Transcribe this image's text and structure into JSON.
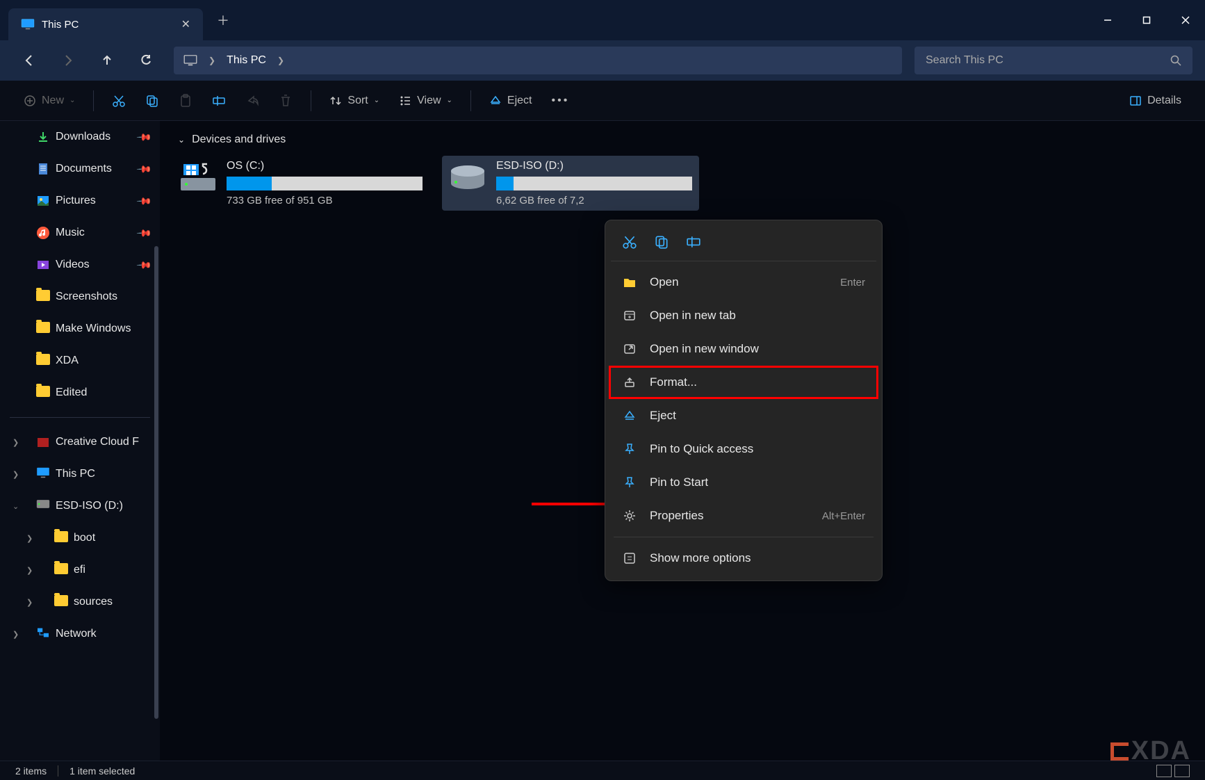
{
  "titlebar": {
    "tab_title": "This PC"
  },
  "breadcrumb": {
    "location": "This PC"
  },
  "search": {
    "placeholder": "Search This PC"
  },
  "toolbar": {
    "new": "New",
    "sort": "Sort",
    "view": "View",
    "eject": "Eject",
    "details": "Details"
  },
  "sidebar": {
    "quick": [
      {
        "label": "Downloads",
        "icon": "download",
        "pinned": true
      },
      {
        "label": "Documents",
        "icon": "doc",
        "pinned": true
      },
      {
        "label": "Pictures",
        "icon": "pic",
        "pinned": true
      },
      {
        "label": "Music",
        "icon": "music",
        "pinned": true
      },
      {
        "label": "Videos",
        "icon": "video",
        "pinned": true
      },
      {
        "label": "Screenshots",
        "icon": "folder",
        "pinned": false
      },
      {
        "label": "Make Windows",
        "icon": "folder",
        "pinned": false
      },
      {
        "label": "XDA",
        "icon": "folder",
        "pinned": false
      },
      {
        "label": "Edited",
        "icon": "folder",
        "pinned": false
      }
    ],
    "tree": [
      {
        "label": "Creative Cloud F",
        "icon": "cc",
        "chev": "right"
      },
      {
        "label": "This PC",
        "icon": "pc",
        "chev": "right"
      },
      {
        "label": "ESD-ISO (D:)",
        "icon": "drive",
        "chev": "down"
      },
      {
        "label": "boot",
        "icon": "folder",
        "nested": true,
        "chev": "right"
      },
      {
        "label": "efi",
        "icon": "folder",
        "nested": true,
        "chev": "right"
      },
      {
        "label": "sources",
        "icon": "folder",
        "nested": true,
        "chev": "right"
      },
      {
        "label": "Network",
        "icon": "net",
        "chev": "right"
      }
    ]
  },
  "section": {
    "header": "Devices and drives"
  },
  "drives": [
    {
      "name": "OS (C:)",
      "free": "733 GB free of 951 GB",
      "pct": 23,
      "selected": false
    },
    {
      "name": "ESD-ISO (D:)",
      "free": "6,62 GB free of 7,2",
      "pct": 9,
      "selected": true
    }
  ],
  "context": {
    "items": [
      {
        "label": "Open",
        "icon": "open",
        "key": "Enter"
      },
      {
        "label": "Open in new tab",
        "icon": "newtab"
      },
      {
        "label": "Open in new window",
        "icon": "newwin"
      },
      {
        "label": "Format...",
        "icon": "format",
        "highlight": true
      },
      {
        "label": "Eject",
        "icon": "eject"
      },
      {
        "label": "Pin to Quick access",
        "icon": "pin"
      },
      {
        "label": "Pin to Start",
        "icon": "pin"
      },
      {
        "label": "Properties",
        "icon": "props",
        "key": "Alt+Enter"
      }
    ],
    "more": "Show more options"
  },
  "status": {
    "count": "2 items",
    "selected": "1 item selected"
  },
  "watermark": "XDA"
}
